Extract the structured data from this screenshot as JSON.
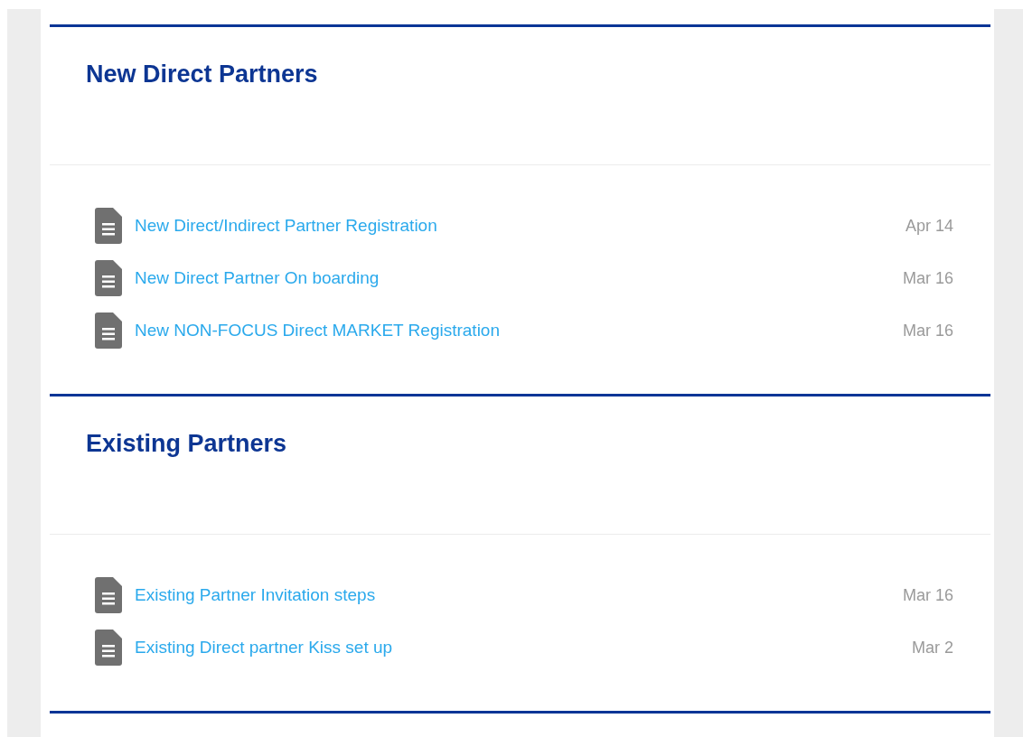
{
  "sections": [
    {
      "title": "New Direct Partners",
      "documents": [
        {
          "name": "New Direct/Indirect Partner Registration",
          "date": "Apr 14"
        },
        {
          "name": "New Direct Partner On boarding",
          "date": "Mar 16"
        },
        {
          "name": "New NON-FOCUS Direct MARKET Registration",
          "date": "Mar 16"
        }
      ]
    },
    {
      "title": "Existing Partners",
      "documents": [
        {
          "name": "Existing Partner Invitation steps",
          "date": "Mar 16"
        },
        {
          "name": "Existing Direct partner Kiss set up",
          "date": "Mar 2"
        }
      ]
    }
  ]
}
